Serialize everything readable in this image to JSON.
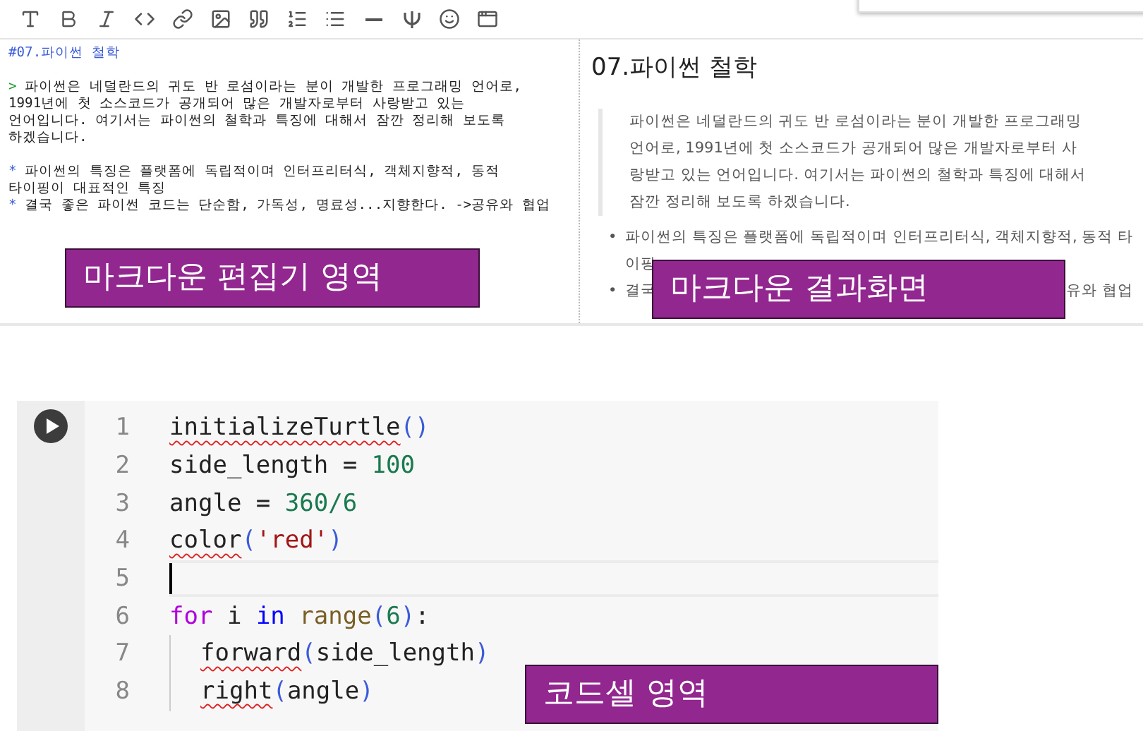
{
  "editor": {
    "lines": [
      {
        "kind": "heading",
        "text": "#07.파이썬 철학"
      },
      {
        "kind": "blank"
      },
      {
        "kind": "quote",
        "marker": ">",
        "text": "파이썬은 네덜란드의 귀도 반 로섬이라는 분이 개발한 프로그래밍 언어로,"
      },
      {
        "kind": "plain",
        "text": "1991년에 첫 소스코드가 공개되어 많은 개발자로부터 사랑받고 있는"
      },
      {
        "kind": "plain",
        "text": "언어입니다. 여기서는 파이썬의 철학과 특징에 대해서 잠깐 정리해 보도록"
      },
      {
        "kind": "plain",
        "text": "하겠습니다."
      },
      {
        "kind": "blank"
      },
      {
        "kind": "bullet",
        "marker": "*",
        "text": "파이썬의 특징은 플랫폼에 독립적이며 인터프리터식, 객체지향적, 동적"
      },
      {
        "kind": "plain",
        "text": "타이핑이 대표적인 특징"
      },
      {
        "kind": "bullet",
        "marker": "*",
        "text": "결국 좋은 파이썬 코드는 단순함, 가독성, 명료성...지향한다. ->공유와 협업"
      }
    ],
    "label": "마크다운 편집기 영역"
  },
  "preview": {
    "heading": "07.파이썬 철학",
    "quote": "파이썬은 네덜란드의 귀도 반 로섬이라는 분이 개발한 프로그래밍 언어로, 1991년에 첫 소스코드가 공개되어 많은 개발자로부터 사랑받고 있는 언어입니다. 여기서는 파이썬의 철학과 특징에 대해서 잠깐 정리해 보도록 하겠습니다.",
    "bullets": [
      {
        "marker": "•",
        "lines": [
          [
            "파이썬의 특징은 플랫폼에 독립적이며 인터프리터식, 객체지향적, 동적 타"
          ],
          [
            "이핑"
          ]
        ]
      },
      {
        "marker": "•",
        "lines": [
          [
            "결국",
            "유와 협업"
          ]
        ]
      }
    ],
    "label": "마크다운 결과화면"
  },
  "code_cell": {
    "lines": [
      {
        "number": "1",
        "current": false,
        "indented": false,
        "tokens": [
          {
            "kind": "name",
            "text": "initializeTurtle",
            "squiggle": true
          },
          {
            "kind": "bracket",
            "text": "()"
          }
        ]
      },
      {
        "number": "2",
        "current": false,
        "indented": false,
        "tokens": [
          {
            "kind": "name",
            "text": "side_length = "
          },
          {
            "kind": "number",
            "text": "100"
          }
        ]
      },
      {
        "number": "3",
        "current": false,
        "indented": false,
        "tokens": [
          {
            "kind": "name",
            "text": "angle = "
          },
          {
            "kind": "number",
            "text": "360/6"
          }
        ]
      },
      {
        "number": "4",
        "current": false,
        "indented": false,
        "tokens": [
          {
            "kind": "name",
            "text": "color",
            "squiggle": true
          },
          {
            "kind": "bracket",
            "text": "("
          },
          {
            "kind": "string",
            "text": "'red'"
          },
          {
            "kind": "bracket",
            "text": ")"
          }
        ]
      },
      {
        "number": "5",
        "current": true,
        "indented": false
      },
      {
        "number": "6",
        "current": false,
        "indented": false,
        "tokens": [
          {
            "kind": "keyword",
            "text": "for"
          },
          {
            "kind": "name",
            "text": " i "
          },
          {
            "kind": "operator",
            "text": "in "
          },
          {
            "kind": "builtin",
            "text": "range"
          },
          {
            "kind": "bracket",
            "text": "("
          },
          {
            "kind": "number",
            "text": "6"
          },
          {
            "kind": "bracket",
            "text": ")"
          },
          {
            "kind": "name",
            "text": ":"
          }
        ]
      },
      {
        "number": "7",
        "current": false,
        "indented": true,
        "tokens": [
          {
            "kind": "name",
            "text": "forward",
            "squiggle": true
          },
          {
            "kind": "bracket",
            "text": "("
          },
          {
            "kind": "name",
            "text": "side_length"
          },
          {
            "kind": "bracket",
            "text": ")"
          }
        ]
      },
      {
        "number": "8",
        "current": false,
        "indented": true,
        "tokens": [
          {
            "kind": "name",
            "text": "right",
            "squiggle": true
          },
          {
            "kind": "bracket",
            "text": "("
          },
          {
            "kind": "name",
            "text": "angle"
          },
          {
            "kind": "bracket",
            "text": ")"
          }
        ]
      }
    ],
    "label": "코드셀 영역"
  }
}
